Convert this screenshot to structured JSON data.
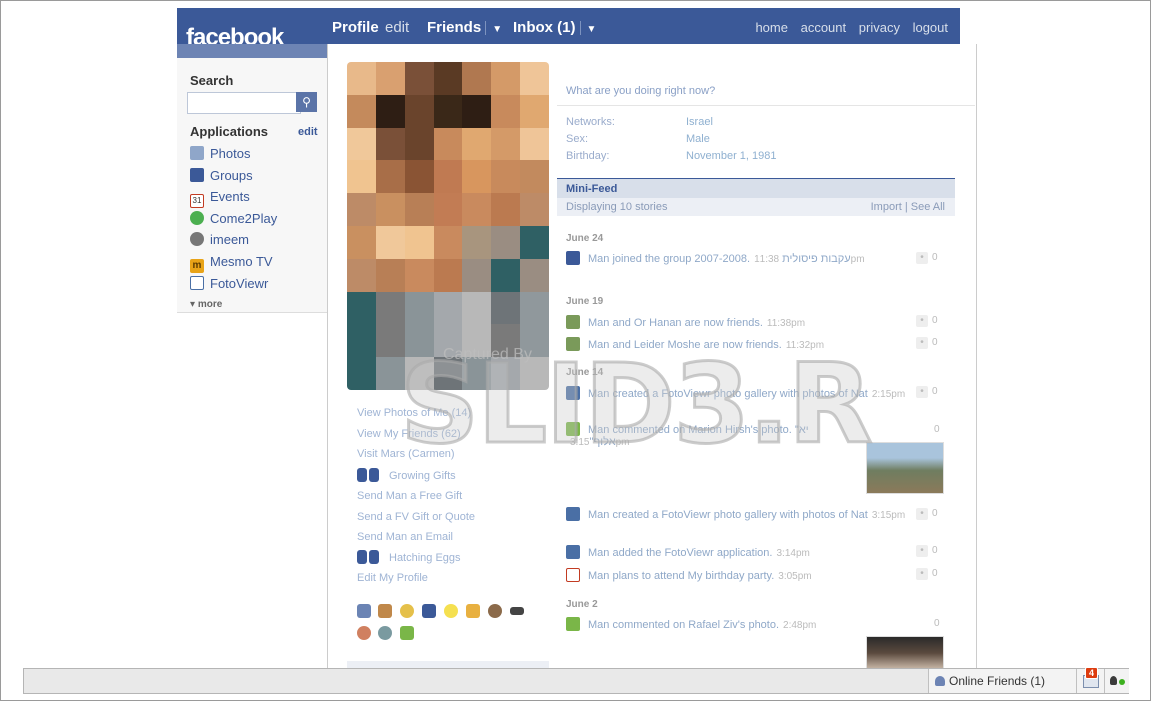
{
  "header": {
    "logo": "facebook",
    "nav": [
      {
        "label": "Profile"
      },
      {
        "label": "edit"
      },
      {
        "label": "Friends"
      },
      {
        "label": "Inbox (1)"
      }
    ],
    "links": [
      "home",
      "account",
      "privacy",
      "logout"
    ]
  },
  "sidebar": {
    "search_label": "Search",
    "search_value": "",
    "applications_label": "Applications",
    "applications_edit": "edit",
    "apps": [
      {
        "label": "Photos",
        "icon": "photos-icon",
        "color": "#8fa6c9"
      },
      {
        "label": "Groups",
        "icon": "groups-icon",
        "color": "#3b5998"
      },
      {
        "label": "Events",
        "icon": "events-icon",
        "color": "#c23b22"
      },
      {
        "label": "Come2Play",
        "icon": "come2play-icon",
        "color": "#4caf50"
      },
      {
        "label": "imeem",
        "icon": "imeem-icon",
        "color": "#777777"
      },
      {
        "label": "Mesmo TV",
        "icon": "mesmo-tv-icon",
        "color": "#e8a317"
      },
      {
        "label": "FotoViewr",
        "icon": "fotoviewr-icon",
        "color": "#4a6fa5"
      }
    ],
    "more_label": "more"
  },
  "profile": {
    "status_prompt": "What are you doing right now?",
    "info": [
      {
        "key": "Networks:",
        "value": "Israel"
      },
      {
        "key": "Sex:",
        "value": "Male"
      },
      {
        "key": "Birthday:",
        "value": "November 1, 1981"
      }
    ],
    "left_links": [
      "View Photos of Me (14)",
      "View My Friends (62)",
      "Visit Mars (Carmen)",
      "Growing Gifts",
      "Send Man a Free Gift",
      "Send a FV Gift or Quote",
      "Send Man an Email",
      "Hatching Eggs",
      "Edit My Profile"
    ]
  },
  "minifeed": {
    "title": "Mini-Feed",
    "displaying": "Displaying 10 stories",
    "actions": "Import | See All",
    "groups": [
      {
        "date": "June 24",
        "items": [
          {
            "text": "Man joined the group  עקבות פיסולית 2007-2008.",
            "time": "11:38pm",
            "icon": "group-icon",
            "count": "0"
          }
        ]
      },
      {
        "date": "June 19",
        "items": [
          {
            "text": "Man and Or Hanan are now friends.",
            "time": "11:38pm",
            "icon": "friends-icon",
            "count": "0"
          },
          {
            "text": "Man and Leider Moshe are now friends.",
            "time": "11:32pm",
            "icon": "friends-icon",
            "count": "0"
          }
        ]
      },
      {
        "date": "June 14",
        "items": [
          {
            "text": "Man created a FotoViewr photo gallery with photos of Nat",
            "time": "2:15pm",
            "icon": "fotoviewr-icon",
            "count": "0"
          },
          {
            "text": "Man commented on Marion Hirsh's photo. \"יא אלוף\"",
            "time": "3:15pm",
            "icon": "comment-icon",
            "count": "0"
          }
        ]
      },
      {
        "date": "",
        "items": [
          {
            "text": "Man created a FotoViewr photo gallery with photos of Nat",
            "time": "3:15pm",
            "icon": "fotoviewr-icon",
            "count": "0"
          },
          {
            "text": "Man added the FotoViewr application.",
            "time": "3:14pm",
            "icon": "fotoviewr-icon",
            "count": "0"
          },
          {
            "text": "Man plans to attend My birthday party.",
            "time": "3:05pm",
            "icon": "calendar-icon",
            "count": "0"
          }
        ]
      },
      {
        "date": "June 2",
        "items": [
          {
            "text": "Man commented on Rafael Ziv's photo.",
            "time": "2:48pm",
            "icon": "comment-icon",
            "count": "0"
          }
        ]
      }
    ]
  },
  "watermark": {
    "caption": "Captured By",
    "brand": "SLID3.R"
  },
  "chat": {
    "online_label": "Online Friends",
    "online_count": "(1)",
    "notification_count": "4"
  },
  "colors": {
    "brand": "#3b5998",
    "nav_light": "#d8dfea",
    "badge": "#dd3c10"
  }
}
